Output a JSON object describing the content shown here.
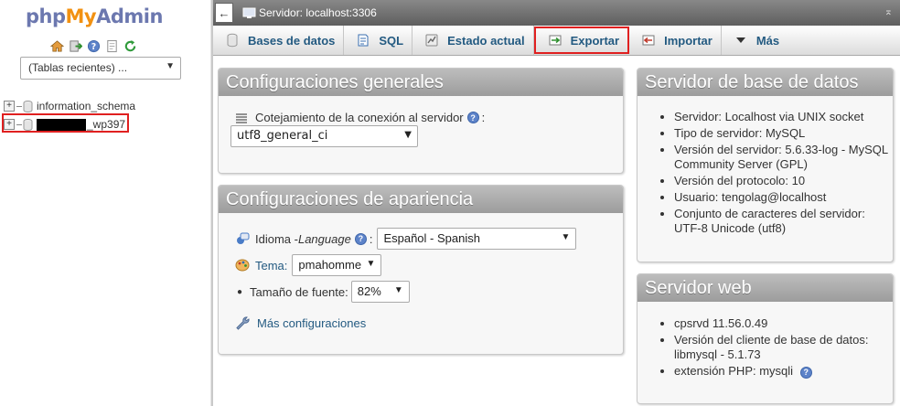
{
  "nav": {
    "logo": {
      "php": "php",
      "my": "My",
      "admin": "Admin"
    },
    "icons": [
      "home-icon",
      "exit-icon",
      "help-icon",
      "docs-icon",
      "reload-icon"
    ],
    "recent_tables": "(Tablas recientes) ...",
    "databases": [
      {
        "name": "information_schema"
      },
      {
        "name": "_wp397",
        "redacted_prefix": true
      }
    ]
  },
  "serverbar": {
    "title": "Servidor: localhost:3306"
  },
  "tabs": [
    {
      "label": "Bases de datos",
      "icon": "database-icon"
    },
    {
      "label": "SQL",
      "icon": "sql-icon"
    },
    {
      "label": "Estado actual",
      "icon": "status-icon"
    },
    {
      "label": "Exportar",
      "icon": "export-icon",
      "highlighted": true
    },
    {
      "label": "Importar",
      "icon": "import-icon"
    },
    {
      "label": "Más",
      "icon": "menu-down-icon"
    }
  ],
  "general": {
    "title": "Configuraciones generales",
    "collation_label": "Cotejamiento de la conexión al servidor",
    "collation_suffix": ":",
    "collation_value": "utf8_general_ci"
  },
  "appearance": {
    "title": "Configuraciones de apariencia",
    "language_label": "Idioma - ",
    "language_label_italic": "Language",
    "language_suffix": ":",
    "language_value": "Español - Spanish",
    "theme_label": "Tema:",
    "theme_value": "pmahomme",
    "font_size_label": "Tamaño de fuente:",
    "font_size_value": "82%",
    "more_settings": "Más configuraciones"
  },
  "db_server": {
    "title": "Servidor de base de datos",
    "items": [
      "Servidor: Localhost via UNIX socket",
      "Tipo de servidor: MySQL",
      "Versión del servidor: 5.6.33-log - MySQL Community Server (GPL)",
      "Versión del protocolo: 10",
      "Usuario: tengolag@localhost",
      "Conjunto de caracteres del servidor: UTF-8 Unicode (utf8)"
    ]
  },
  "web_server": {
    "title": "Servidor web",
    "items": [
      "cpsrvd 11.56.0.49",
      "Versión del cliente de base de datos: libmysql - 5.1.73",
      "extensión PHP: mysqli"
    ]
  },
  "colors": {
    "accent": "#235a81",
    "highlight": "#e02020",
    "logo_orange": "#f29111",
    "logo_blue": "#6c78af"
  }
}
